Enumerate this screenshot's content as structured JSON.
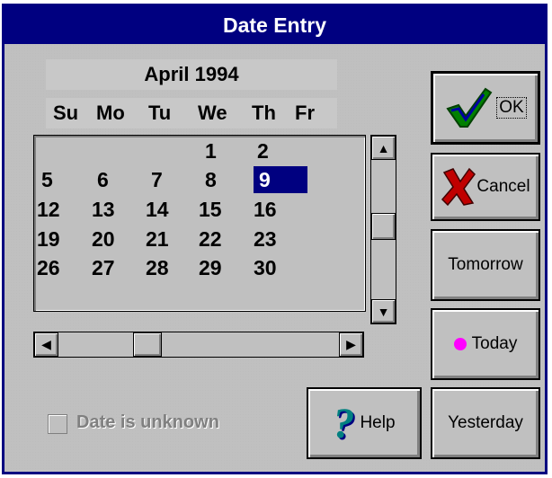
{
  "window": {
    "title": "Date Entry"
  },
  "calendar": {
    "month_label": "April 1994",
    "weekdays": [
      "Su",
      "Mo",
      "Tu",
      "We",
      "Th",
      "Fr"
    ],
    "weeks": [
      [
        "",
        "",
        "",
        "1",
        "2"
      ],
      [
        "5",
        "6",
        "7",
        "8",
        "9"
      ],
      [
        "12",
        "13",
        "14",
        "15",
        "16"
      ],
      [
        "19",
        "20",
        "21",
        "22",
        "23"
      ],
      [
        "26",
        "27",
        "28",
        "29",
        "30"
      ]
    ],
    "selected_day": "9"
  },
  "buttons": {
    "ok": "OK",
    "cancel": "Cancel",
    "tomorrow": "Tomorrow",
    "today": "Today",
    "yesterday": "Yesterday",
    "help": "Help"
  },
  "checkbox": {
    "label": "Date is unknown",
    "checked": false
  },
  "colors": {
    "title_bar": "#000080",
    "selection": "#000080",
    "today_dot": "#ff00ff"
  }
}
